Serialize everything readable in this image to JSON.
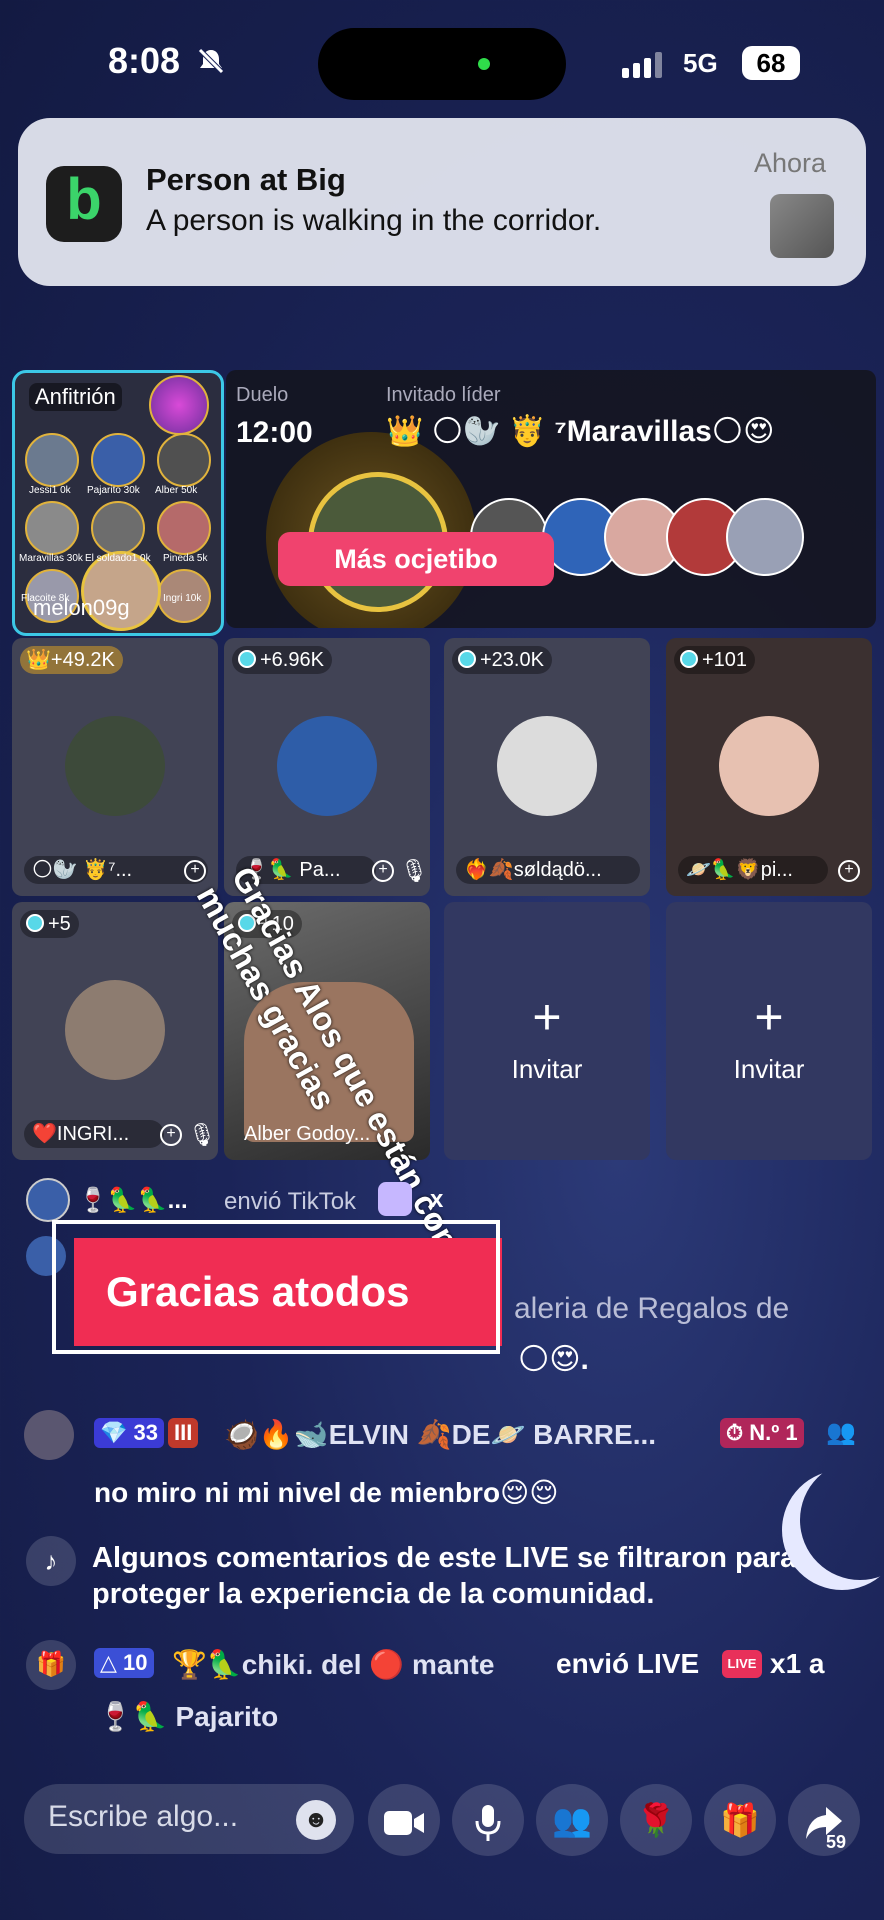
{
  "status": {
    "time": "8:08",
    "network": "5G",
    "battery": "68"
  },
  "notification": {
    "app_letter": "b",
    "title": "Person at Big",
    "body": "A person is walking in the corridor.",
    "time": "Ahora"
  },
  "host": {
    "label": "Anfitrión",
    "name": "melon09g",
    "mini_labels": [
      "Jessi1 0k",
      "Pajarito 30k",
      "Alber 50k",
      "Maravillas 30k",
      "El soldado1 0k",
      "Pineda 5k",
      "Flacoite 8k",
      "",
      "Ingri 10k"
    ]
  },
  "duel": {
    "label": "Duelo",
    "timer": "12:00",
    "leader_label": "Invitado líder",
    "leader_name": "👑 🌕🦭 🤴 ⁷Maravillas🌕😍",
    "button": "Más ocjetibo"
  },
  "seats": [
    {
      "score": "+49.2K",
      "name": "🌕🦭 🤴⁷...",
      "crown": true
    },
    {
      "score": "+6.96K",
      "name": "🍷🦜 Pa..."
    },
    {
      "score": "+23.0K",
      "name": "❤️‍🔥🍂søldądö..."
    },
    {
      "score": "+101",
      "name": "🪐🦜🦁pi..."
    },
    {
      "score": "+5",
      "name": "❤️INGRI..."
    },
    {
      "score": "+10",
      "name": "Alber Godoy..."
    }
  ],
  "invite_label": "Invitar",
  "overlay_text": "Gracias Alos que están conmigo muchas gracias",
  "chat": {
    "gift_row": {
      "user": "🍷🦜🦜...",
      "action": "envió TikTok",
      "count": "x"
    },
    "sticker_text": "Gracias  atodos",
    "gallery_text": "aleria de Regalos de",
    "gallery_tail": "🌕😍.",
    "elvin": {
      "level": "33",
      "badge2": "III",
      "name": "🥥🔥🐋ELVIN 🍂DE🪐 BARRE...",
      "rank": "N.º 1",
      "message": "no miro ni mi nivel de mienbro😌😌"
    },
    "system": "Algunos comentarios de este LIVE se filtraron para proteger la experiencia de la comunidad.",
    "gift": {
      "level": "10",
      "line1": "🏆🦜chiki. del 🔴  mante",
      "action": "envió LIVE",
      "count": "x1 a",
      "recipient": "🍷🦜 Pajarito"
    }
  },
  "bottom": {
    "placeholder": "Escribe algo...",
    "share_count": "59"
  },
  "colors": {
    "accent": "#f0436e",
    "host_border": "#3cc8e6",
    "sticker": "#f02d53"
  }
}
